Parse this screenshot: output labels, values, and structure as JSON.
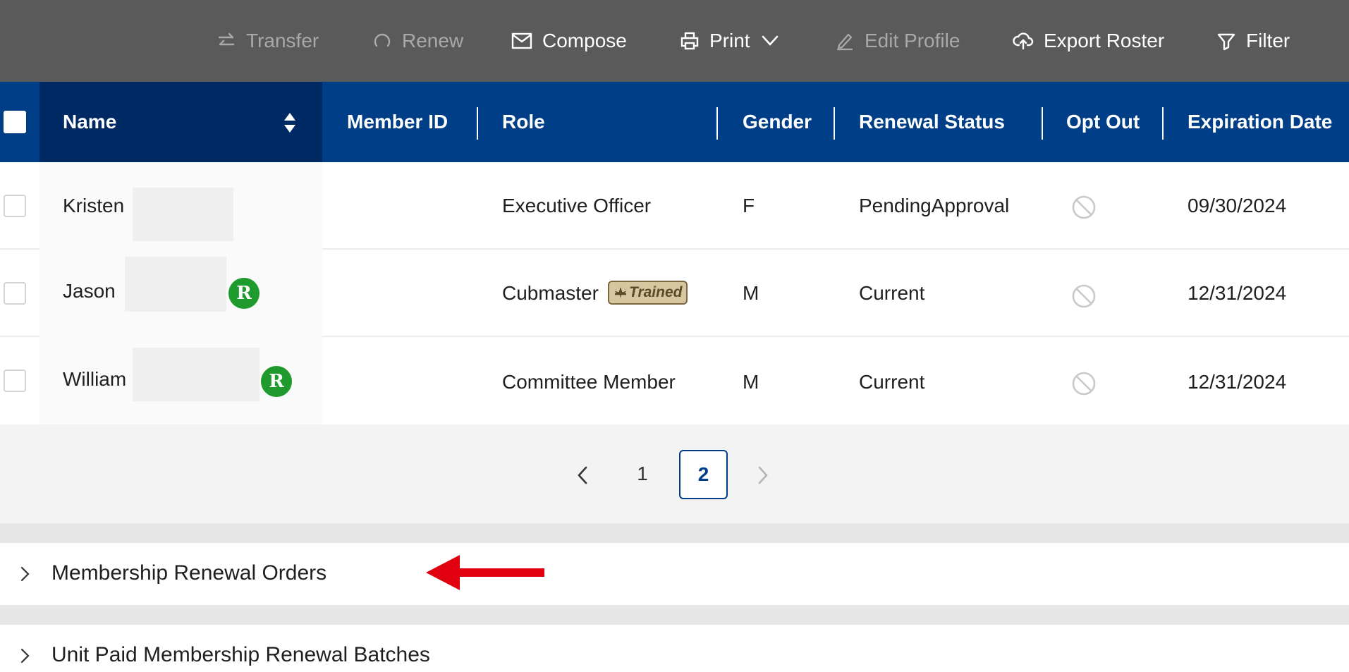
{
  "toolbar": {
    "transfer": "Transfer",
    "renew": "Renew",
    "compose": "Compose",
    "print": "Print",
    "edit_profile": "Edit Profile",
    "export_roster": "Export Roster",
    "filter": "Filter"
  },
  "table": {
    "columns": {
      "name": "Name",
      "member_id": "Member ID",
      "role": "Role",
      "gender": "Gender",
      "renewal_status": "Renewal Status",
      "opt_out": "Opt Out",
      "expiration_date": "Expiration Date"
    },
    "rows": [
      {
        "name": "Kristen",
        "role": "Executive Officer",
        "gender": "F",
        "renewal_status": "PendingApproval",
        "expiration_date": "09/30/2024"
      },
      {
        "name": "Jason",
        "role": "Cubmaster",
        "trained_badge": "Trained",
        "gender": "M",
        "renewal_status": "Current",
        "expiration_date": "12/31/2024",
        "badge": "R"
      },
      {
        "name": "William",
        "role": "Committee Member",
        "gender": "M",
        "renewal_status": "Current",
        "expiration_date": "12/31/2024",
        "badge": "R"
      }
    ]
  },
  "pagination": {
    "page1": "1",
    "page2": "2",
    "current": "2"
  },
  "sections": {
    "renewal_orders": "Membership Renewal Orders",
    "renewal_batches": "Unit Paid Membership Renewal Batches"
  },
  "colors": {
    "toolbar_bg": "#5a5a5a",
    "header_bg": "#003f87",
    "header_sorted_bg": "#002a63",
    "badge_green": "#1f9a2c",
    "arrow_red": "#e0000f"
  }
}
